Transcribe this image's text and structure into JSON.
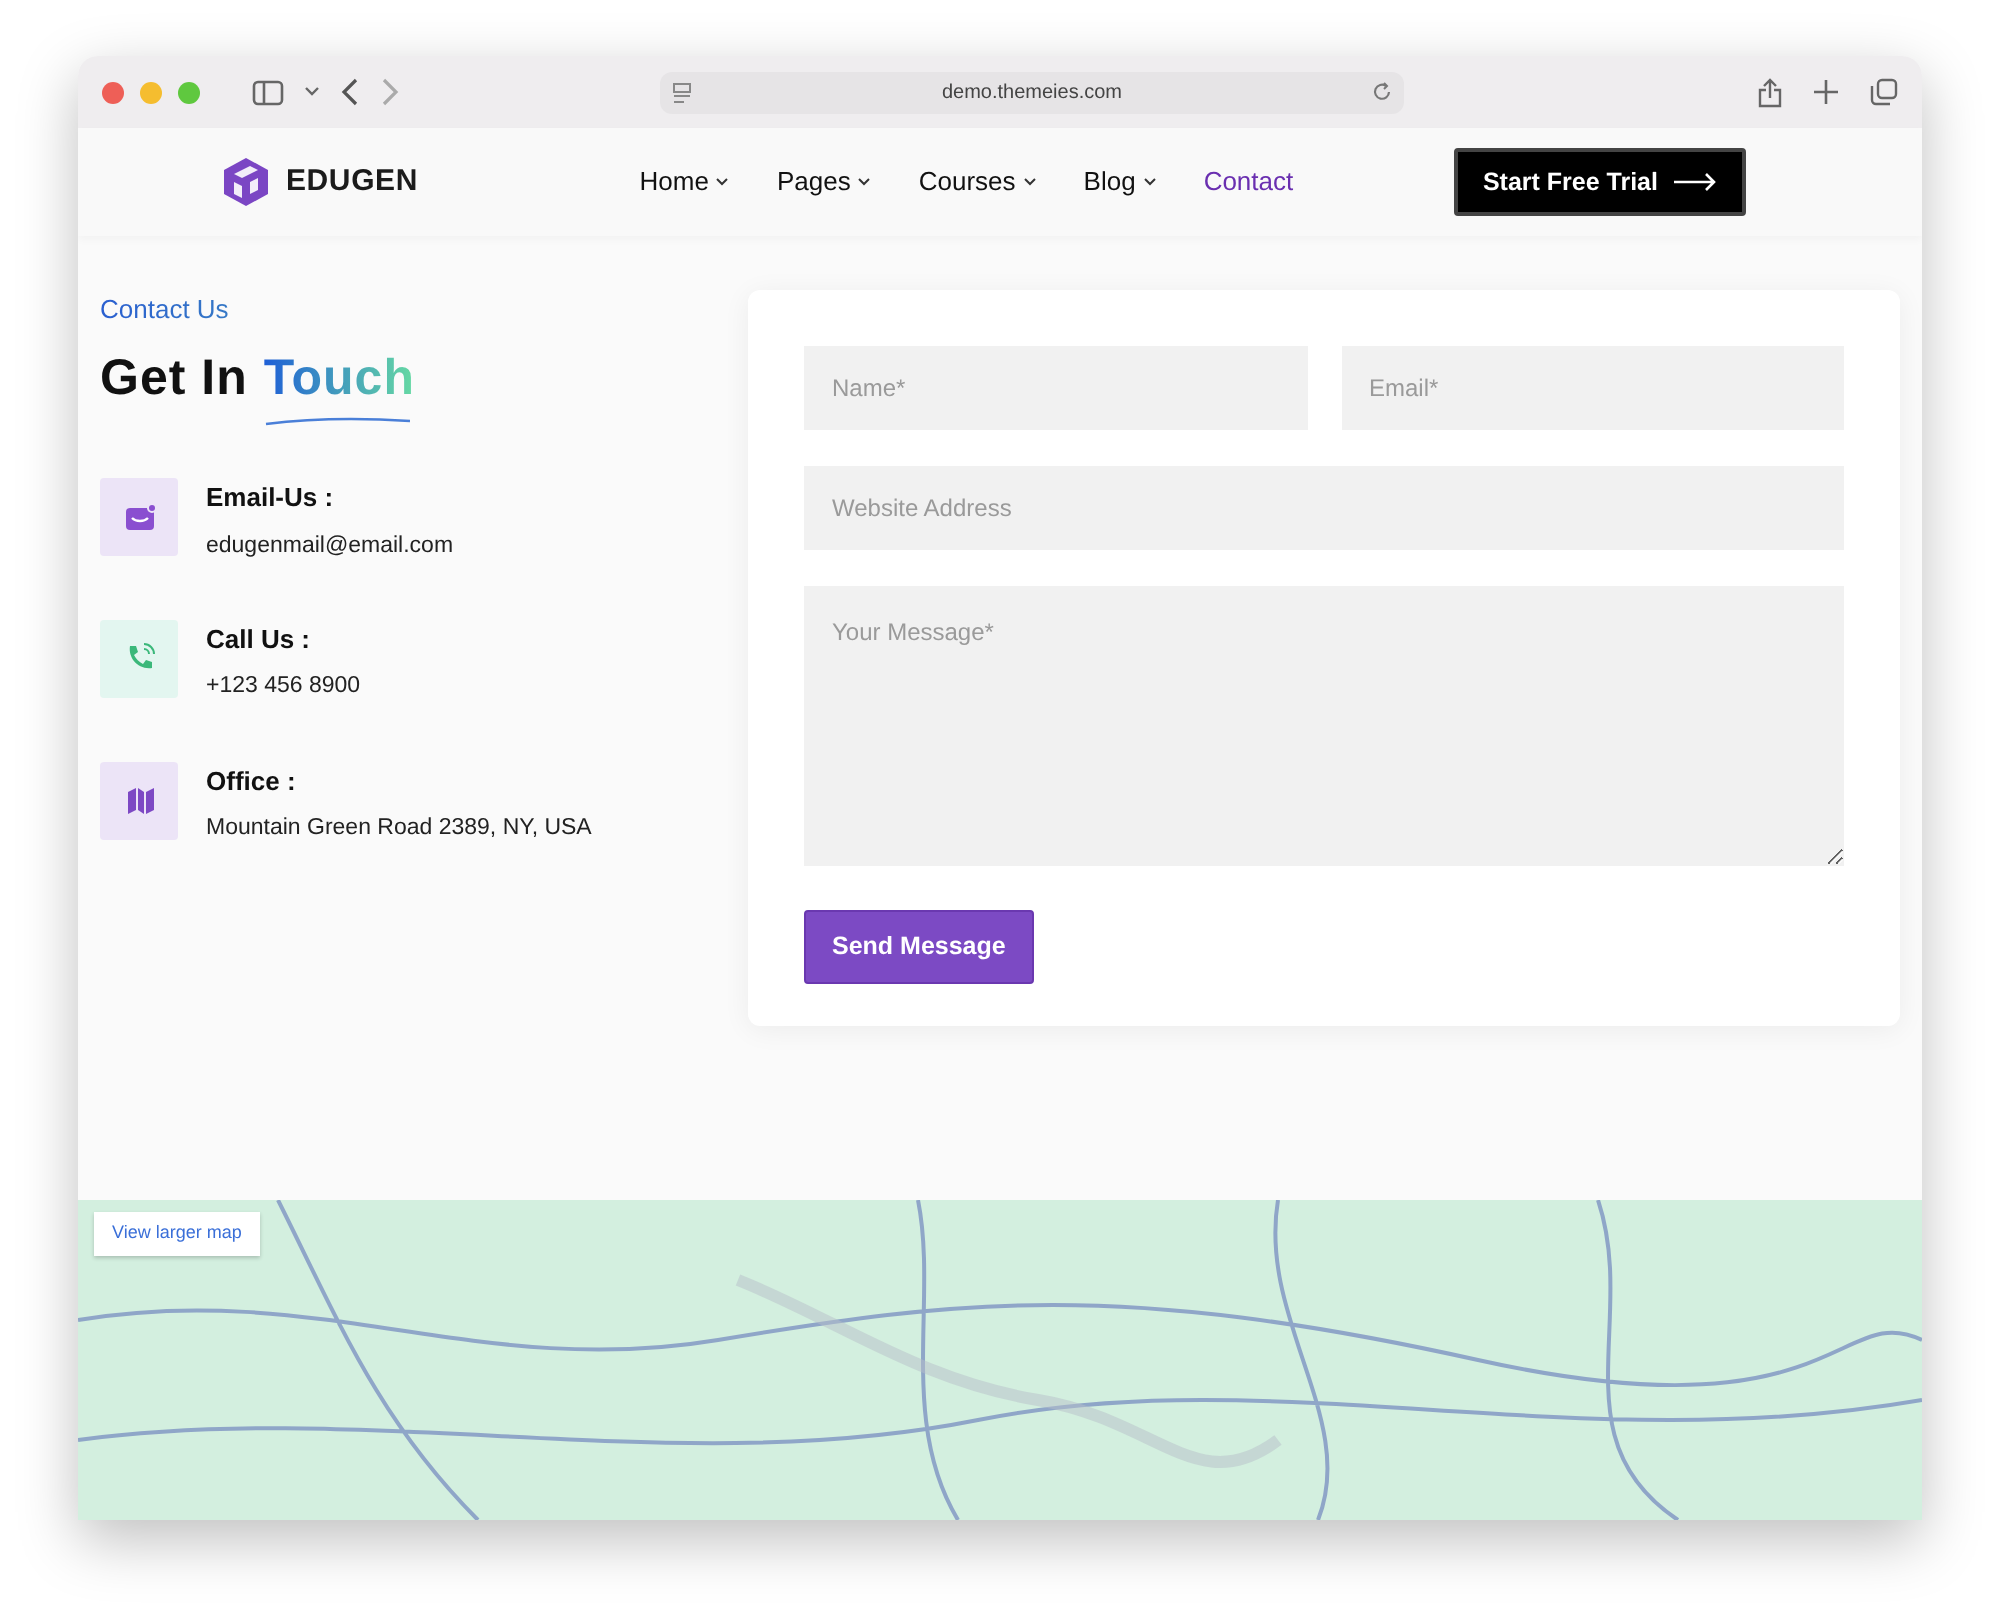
{
  "browser": {
    "url": "demo.themeies.com"
  },
  "nav": {
    "brand": "EDUGEN",
    "links": [
      {
        "label": "Home",
        "dropdown": true,
        "selected": false
      },
      {
        "label": "Pages",
        "dropdown": true,
        "selected": false
      },
      {
        "label": "Courses",
        "dropdown": true,
        "selected": false
      },
      {
        "label": "Blog",
        "dropdown": true,
        "selected": false
      },
      {
        "label": "Contact",
        "dropdown": false,
        "selected": true
      }
    ],
    "cta": "Start Free Trial"
  },
  "contact": {
    "eyebrow": "Contact Us",
    "heading": "Get In",
    "heading_accent": "Touch",
    "items": [
      {
        "kind": "email",
        "title": "Email-Us :",
        "value": "edugenmail@email.com"
      },
      {
        "kind": "phone",
        "title": "Call Us :",
        "value": "+123 456 8900"
      },
      {
        "kind": "office",
        "title": "Office :",
        "value": "Mountain Green Road 2389, NY, USA"
      }
    ]
  },
  "form": {
    "rows": [
      [
        {
          "kind": "text",
          "placeholder": "Name*"
        },
        {
          "kind": "text",
          "placeholder": "Email*"
        }
      ],
      [
        {
          "kind": "text",
          "placeholder": "Website Address"
        }
      ],
      [
        {
          "kind": "textarea",
          "placeholder": "Your Message*"
        }
      ]
    ],
    "submit": "Send Message"
  },
  "map": {
    "link": "View larger map"
  }
}
